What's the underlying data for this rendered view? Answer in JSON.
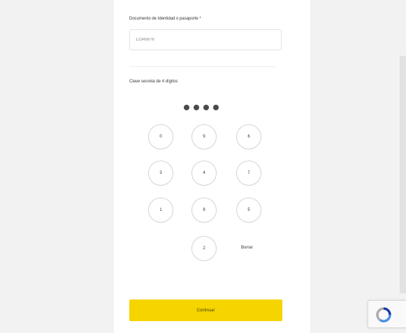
{
  "form": {
    "document_label": "Documento de Identidad o pasaporte *",
    "document_value": "12345678",
    "pin_label": "Clave secreta de 4 dígitos",
    "pin_filled_count": 4
  },
  "keypad": {
    "rows": [
      [
        "0",
        "9",
        "6"
      ],
      [
        "3",
        "4",
        "7"
      ],
      [
        "1",
        "8",
        "5"
      ],
      [
        "2"
      ]
    ],
    "erase_label": "Borrar"
  },
  "actions": {
    "continue_label": "Continuar"
  },
  "colors": {
    "accent": "#f5d400",
    "page_background": "#f2f2f2",
    "pin_dot": "#4a4a4a"
  },
  "icons": {
    "recaptcha": "recaptcha-icon"
  }
}
